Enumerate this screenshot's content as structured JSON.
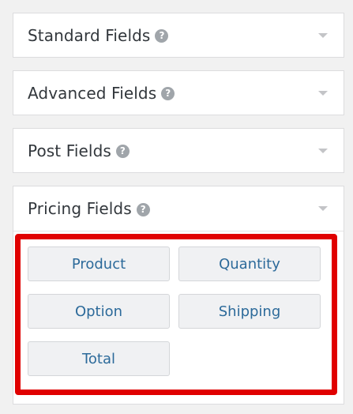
{
  "panels": [
    {
      "title": "Standard Fields",
      "help_icon": "question-circle-icon",
      "state": "collapsed"
    },
    {
      "title": "Advanced Fields",
      "help_icon": "question-circle-icon",
      "state": "collapsed"
    },
    {
      "title": "Post Fields",
      "help_icon": "question-circle-icon",
      "state": "collapsed"
    },
    {
      "title": "Pricing Fields",
      "help_icon": "question-circle-icon",
      "state": "expanded"
    }
  ],
  "help_glyph": "?",
  "pricing_fields": {
    "buttons": [
      "Product",
      "Quantity",
      "Option",
      "Shipping",
      "Total"
    ]
  },
  "colors": {
    "highlight": "#e00000",
    "button_text": "#2c6a9a",
    "title_text": "#32373c"
  }
}
